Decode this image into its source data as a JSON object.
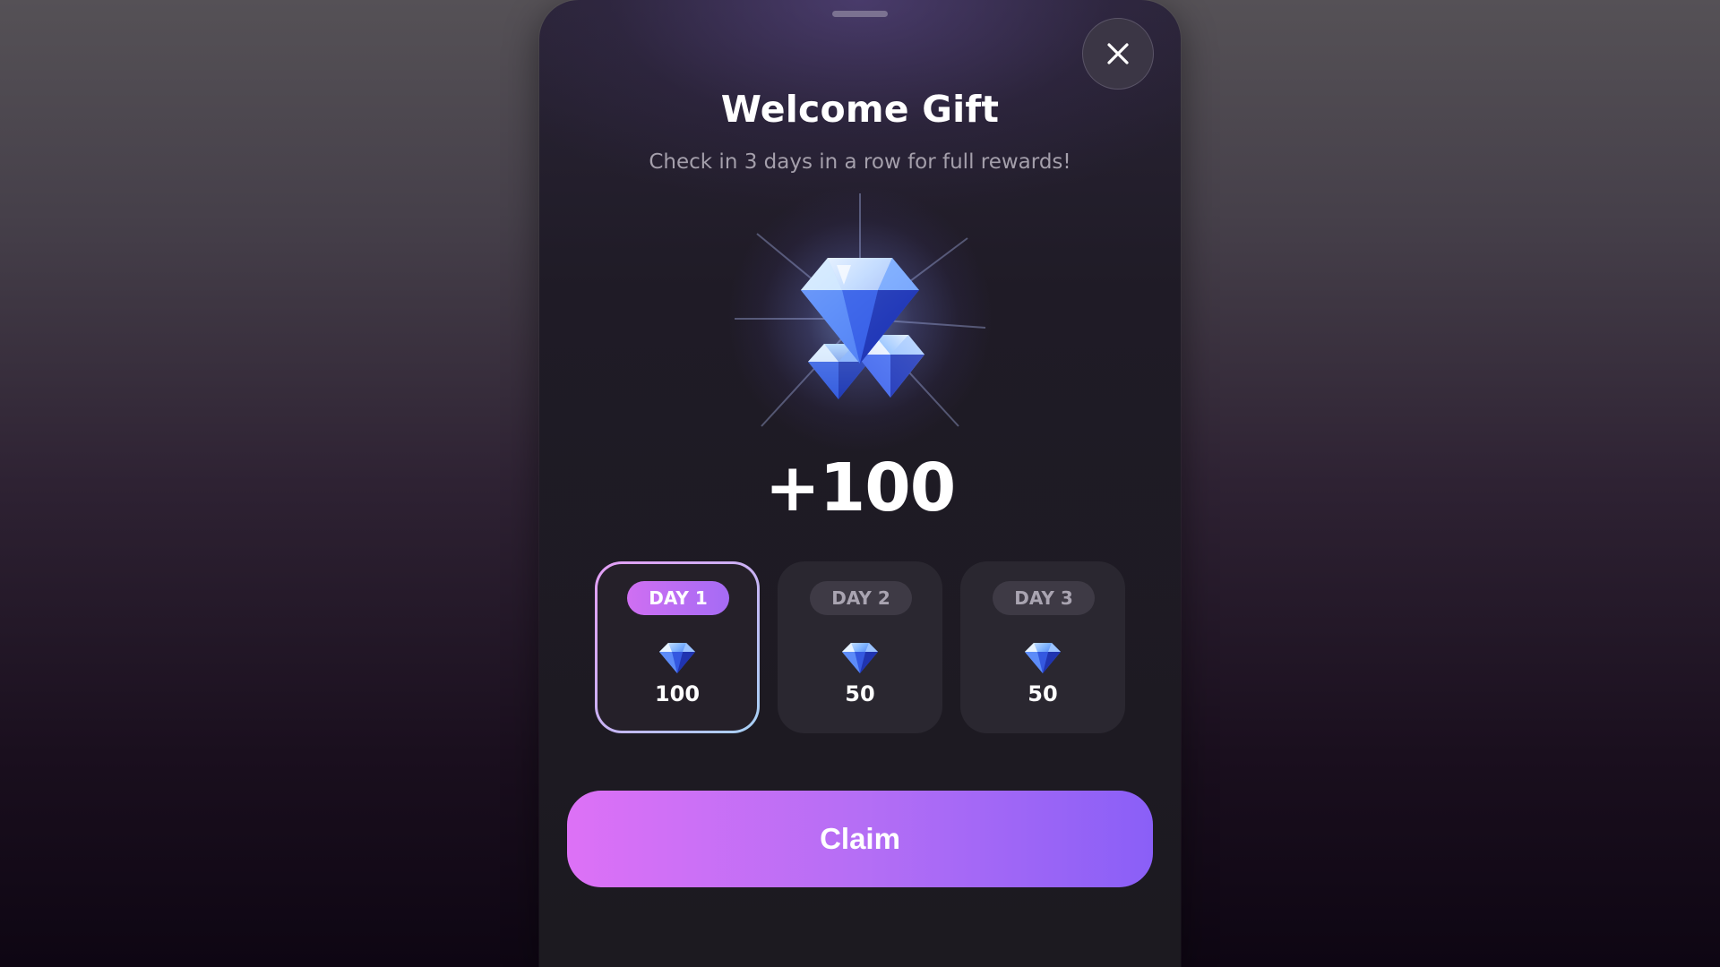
{
  "modal": {
    "title": "Welcome Gift",
    "subtitle": "Check in 3 days in a row for full rewards!",
    "reward_amount": "+100",
    "hero_icon": "diamond-cluster-icon",
    "close_icon": "close-icon"
  },
  "days": [
    {
      "label": "DAY 1",
      "value": "100",
      "active": true,
      "icon": "diamond-icon"
    },
    {
      "label": "DAY 2",
      "value": "50",
      "active": false,
      "icon": "diamond-icon"
    },
    {
      "label": "DAY 3",
      "value": "50",
      "active": false,
      "icon": "diamond-icon"
    }
  ],
  "claim": {
    "label": "Claim"
  },
  "colors": {
    "accent_start": "#dd71f6",
    "accent_end": "#8a5ff7",
    "modal_bg": "#1e1b23",
    "gem_blue": "#4a7dff"
  }
}
